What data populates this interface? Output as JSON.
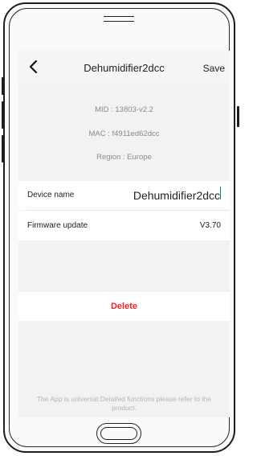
{
  "header": {
    "title": "Dehumidifier2dcc",
    "save_label": "Save",
    "back_icon": "chevron-left-icon"
  },
  "device_info": {
    "mid": "MID : 13803-v2.2",
    "mac": "MAC : f4911ed62dcc",
    "region": "Region : Europe"
  },
  "settings": {
    "device_name_label": "Device name",
    "device_name_value": "Dehumidifier2dcc",
    "firmware_label": "Firmware update",
    "firmware_value": "V3.70"
  },
  "actions": {
    "delete_label": "Delete"
  },
  "footer": {
    "line1": "The App is universal.Detailed functions please refer to the",
    "line2": "product."
  },
  "colors": {
    "delete": "#e3262c",
    "caret": "#1a8a6e",
    "background": "#f2f2f2"
  }
}
